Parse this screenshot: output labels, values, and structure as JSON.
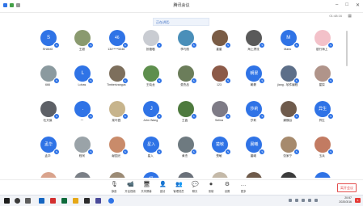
{
  "window": {
    "title": "腾讯会议"
  },
  "topbar": {
    "timer": "01:48:16"
  },
  "toast": {
    "text": "正在讲话:"
  },
  "participants": [
    {
      "name": "SHANG",
      "initial": "S",
      "color": "#2f73e6"
    },
    {
      "name": "王超",
      "initial": "",
      "color": "#8a9a6f"
    },
    {
      "name": "134*****5346",
      "initial": "46",
      "color": "#2f73e6"
    },
    {
      "name": "张璐璐",
      "initial": "",
      "color": "#c9ccd2"
    },
    {
      "name": "李巧丽",
      "initial": "",
      "color": "#4a8fb9"
    },
    {
      "name": "星星",
      "initial": "",
      "color": "#7a5c45"
    },
    {
      "name": "海上漂流",
      "initial": "",
      "color": "#5a5a5a"
    },
    {
      "name": "Mario",
      "initial": "M",
      "color": "#2f73e6"
    },
    {
      "name": "银行海上",
      "initial": "",
      "color": "#f3c1c9"
    },
    {
      "name": "666",
      "initial": "",
      "color": "#8b9a9f"
    },
    {
      "name": "Lohas",
      "initial": "L",
      "color": "#2f73e6"
    },
    {
      "name": "Timberivangus",
      "initial": "",
      "color": "#7d6f5c"
    },
    {
      "name": "王晓龙",
      "initial": "",
      "color": "#5e8f4d"
    },
    {
      "name": "费杰品",
      "initial": "",
      "color": "#6b7d5a"
    },
    {
      "name": "123",
      "initial": "",
      "color": "#8c5a48"
    },
    {
      "name": "朝晏",
      "initial": "朝晏",
      "color": "#2f73e6"
    },
    {
      "name": "jiang - 软件编程",
      "initial": "",
      "color": "#5d6f89"
    },
    {
      "name": "星探",
      "initial": "",
      "color": "#b0948a"
    },
    {
      "name": "杜天保",
      "initial": "",
      "color": "#5d6066"
    },
    {
      "name": "一",
      "initial": ".",
      "color": "#2f73e6"
    },
    {
      "name": "菜叶园",
      "initial": "",
      "color": "#c7b48c"
    },
    {
      "name": "John Wang",
      "initial": "J",
      "color": "#2f73e6"
    },
    {
      "name": "王鑫",
      "initial": "",
      "color": "#4e7a3e"
    },
    {
      "name": "Selina",
      "initial": "",
      "color": "#7e7b86"
    },
    {
      "name": "莎莉",
      "initial": "莎莉",
      "color": "#2f73e6"
    },
    {
      "name": "蝴蝶谷",
      "initial": "",
      "color": "#6f5b4c"
    },
    {
      "name": "异生",
      "initial": "异生",
      "color": "#2f73e6"
    },
    {
      "name": "孟华",
      "initial": "孟华",
      "color": "#2f73e6"
    },
    {
      "name": "程柯",
      "initial": "",
      "color": "#9aa3a8"
    },
    {
      "name": "献国光",
      "initial": "",
      "color": "#c98b6a"
    },
    {
      "name": "星入",
      "initial": "星入",
      "color": "#2f73e6"
    },
    {
      "name": "黄杰",
      "initial": "",
      "color": "#6e7a80"
    },
    {
      "name": "楚敏",
      "initial": "楚敏",
      "color": "#2f73e6"
    },
    {
      "name": "晨曦",
      "initial": "晨曦",
      "color": "#2f73e6"
    },
    {
      "name": "张家宁",
      "initial": "",
      "color": "#a68a6d"
    },
    {
      "name": "玉兵",
      "initial": "",
      "color": "#c27b62"
    },
    {
      "name": "",
      "initial": "",
      "color": "#d9a38c"
    },
    {
      "name": "",
      "initial": "",
      "color": "#7a7f86"
    },
    {
      "name": "",
      "initial": "",
      "color": "#9b8a74"
    },
    {
      "name": "",
      "initial": "杨",
      "color": "#2f73e6"
    },
    {
      "name": "",
      "initial": "",
      "color": "#6a7079"
    },
    {
      "name": "",
      "initial": "",
      "color": "#c4b9a8"
    },
    {
      "name": "",
      "initial": "",
      "color": "#6e5a4a"
    },
    {
      "name": "",
      "initial": "",
      "color": "#3b3b3b"
    },
    {
      "name": "",
      "initial": "L",
      "color": "#2f73e6"
    }
  ],
  "toolbar": {
    "items": [
      {
        "label": "静音",
        "icon": "🎙"
      },
      {
        "label": "开启视频",
        "icon": "📹"
      },
      {
        "label": "共享屏幕",
        "icon": "🖥"
      },
      {
        "label": "邀请",
        "icon": "👤"
      },
      {
        "label": "管理成员",
        "icon": "👥"
      },
      {
        "label": "聊天",
        "icon": "💬"
      },
      {
        "label": "录制",
        "icon": "⏺"
      },
      {
        "label": "设置",
        "icon": "⚙"
      },
      {
        "label": "更多",
        "icon": "…"
      }
    ],
    "end_label": "离开会议"
  },
  "taskbar": {
    "time": "20:57",
    "date": "2020/3/16",
    "notifications": "6"
  }
}
